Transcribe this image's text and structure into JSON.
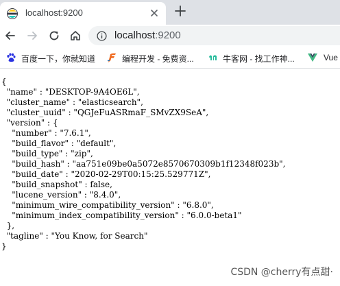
{
  "tab": {
    "title": "localhost:9200"
  },
  "address_bar": {
    "host": "localhost",
    "port": ":9200"
  },
  "bookmarks": [
    {
      "label": "百度一下，你就知道",
      "icon": "baidu-paw-icon"
    },
    {
      "label": "编程开发 - 免费资...",
      "icon": "feather-icon"
    },
    {
      "label": "牛客网 - 找工作神...",
      "icon": "nowcoder-icon"
    },
    {
      "label": "Vue",
      "icon": "vue-icon"
    }
  ],
  "json_lines": [
    "{",
    "  \"name\" : \"DESKTOP-9A4OE6L\",",
    "  \"cluster_name\" : \"elasticsearch\",",
    "  \"cluster_uuid\" : \"QGJeFuASRmaF_SMvZX9SeA\",",
    "  \"version\" : {",
    "    \"number\" : \"7.6.1\",",
    "    \"build_flavor\" : \"default\",",
    "    \"build_type\" : \"zip\",",
    "    \"build_hash\" : \"aa751e09be0a5072e8570670309b1f12348f023b\",",
    "    \"build_date\" : \"2020-02-29T00:15:25.529771Z\",",
    "    \"build_snapshot\" : false,",
    "    \"lucene_version\" : \"8.4.0\",",
    "    \"minimum_wire_compatibility_version\" : \"6.8.0\",",
    "    \"minimum_index_compatibility_version\" : \"6.0.0-beta1\"",
    "  },",
    "  \"tagline\" : \"You Know, for Search\"",
    "}"
  ],
  "watermark": "CSDN @cherry有点甜·",
  "colors": {
    "tabstrip": "#dee1e6",
    "omnibox": "#f1f3f4",
    "vue_green": "#41b883",
    "baidu_blue": "#2932e1"
  }
}
